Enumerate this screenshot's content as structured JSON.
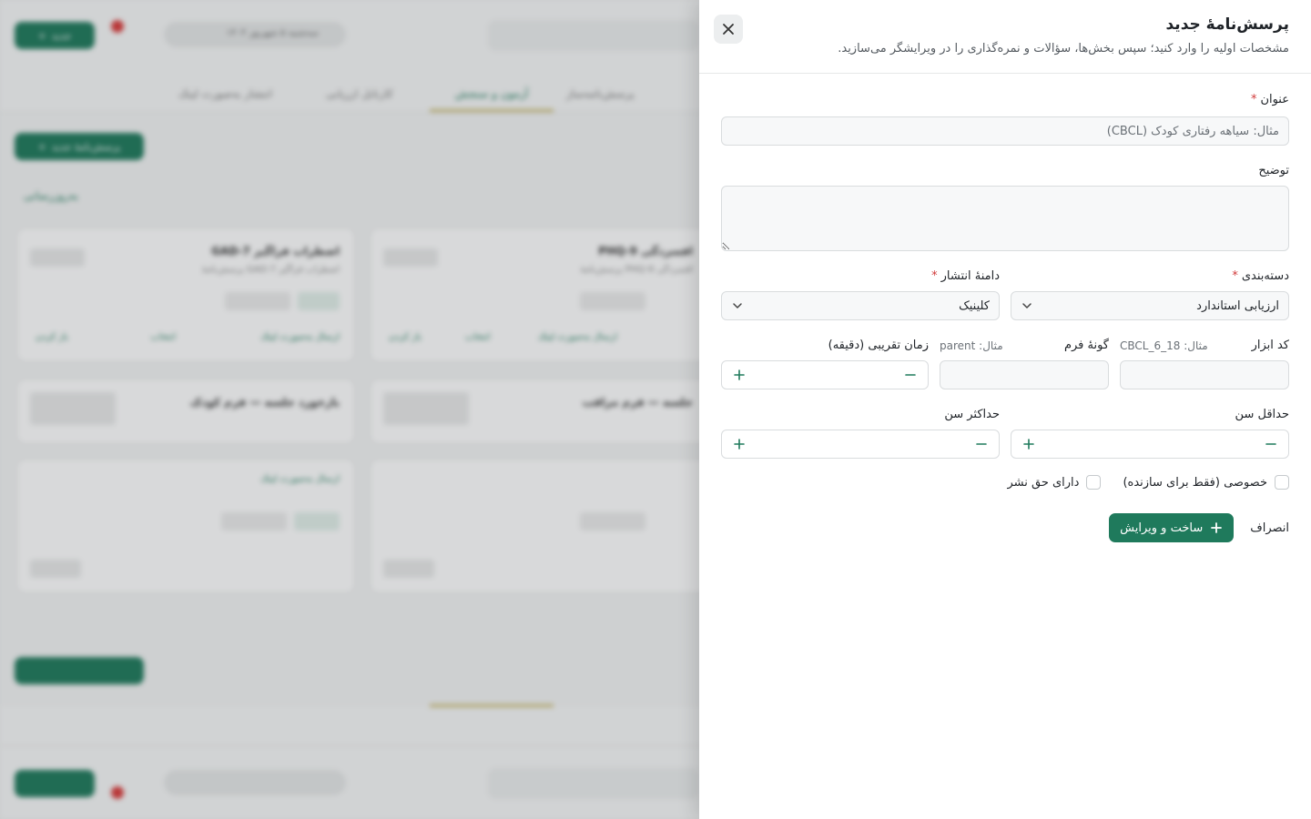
{
  "drawer": {
    "title": "پرسش‌نامهٔ جدید",
    "subtitle": "مشخصات اولیه را وارد کنید؛ سپس بخش‌ها، سؤالات و نمره‌گذاری را در ویرایشگر می‌سازید."
  },
  "form": {
    "title_label": "عنوان",
    "title_placeholder": "مثال: سیاهه رفتاری کودک (CBCL)",
    "description_label": "توضیح",
    "category_label": "دسته‌بندی",
    "category_value": "ارزیابی استاندارد",
    "scope_label": "دامنهٔ انتشار",
    "scope_value": "کلینیک",
    "tool_code_label": "کد ابزار",
    "tool_code_hint": "مثال: CBCL_6_18",
    "form_type_label": "گونهٔ فرم",
    "form_type_hint": "مثال: parent",
    "duration_label": "زمان تقریبی (دقیقه)",
    "min_age_label": "حداقل سن",
    "max_age_label": "حداکثر سن",
    "private_label": "خصوصی (فقط برای سازنده)",
    "copyright_label": "دارای حق نشر"
  },
  "actions": {
    "create_label": "ساخت و ویرایش",
    "cancel_label": "انصراف"
  },
  "background": {
    "new_button": "جدید",
    "date_pill": "سه‌شنبه ۵ شهریور ۱۴۰۴",
    "tabs": [
      "انتشار به‌صورت لینک",
      "کارتابل ارزیابی",
      "آزمون و سنجش",
      "پرسش‌نامه‌ساز"
    ],
    "new_questionnaire": "پرسش‌نامهٔ جدید",
    "refresh": "به‌روزرسانی",
    "cards": [
      {
        "title": "GAD-7 اضطراب فراگیر",
        "sub": "پرسش‌نامهٔ GAD-7 اضطراب فراگیر"
      },
      {
        "title": "PHQ-9 افسردگی",
        "sub": "پرسش‌نامهٔ PHQ-9 افسردگی"
      },
      {
        "title": "بازخورد جلسه — فرم کودک",
        "sub": ""
      },
      {
        "title": "جلسه — فرم مراقب",
        "sub": ""
      }
    ],
    "card_links": [
      "ارسال به‌صورت لینک",
      "انتخاب",
      "باز کردن"
    ],
    "colors": {
      "brand": "#1f7a5c",
      "accent": "#c9b86a",
      "danger": "#d93b3b"
    }
  }
}
